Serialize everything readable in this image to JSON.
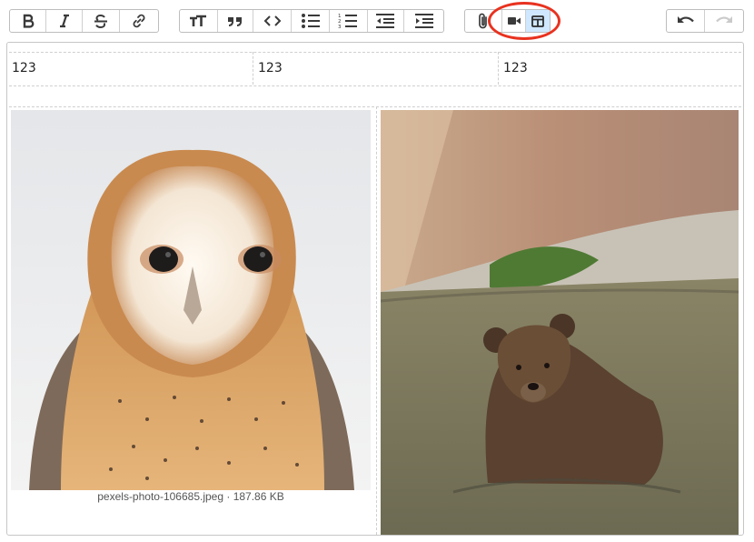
{
  "toolbar": {
    "text_group": [
      "bold-icon",
      "italic-icon",
      "strikethrough-icon",
      "link-icon"
    ],
    "block_group": [
      "heading-icon",
      "quote-icon",
      "code-icon",
      "bullet-list-icon",
      "numbered-list-icon",
      "outdent-icon",
      "indent-icon"
    ],
    "attach_group": [
      "paperclip-icon",
      "video-icon",
      "table-layout-icon"
    ],
    "history_group": [
      "undo-icon",
      "redo-icon"
    ],
    "active_button": "table-layout-icon",
    "disabled_button": "redo-icon",
    "highlight_color": "#e8321f"
  },
  "table": {
    "row1": [
      "123",
      "123",
      "123"
    ]
  },
  "images": {
    "left_caption": "pexels-photo-106685.jpeg · 187.86 KB"
  },
  "colors": {
    "active_bg": "#cfe8ff",
    "border": "#bdbdbd",
    "dashed": "#cfcfcf"
  }
}
